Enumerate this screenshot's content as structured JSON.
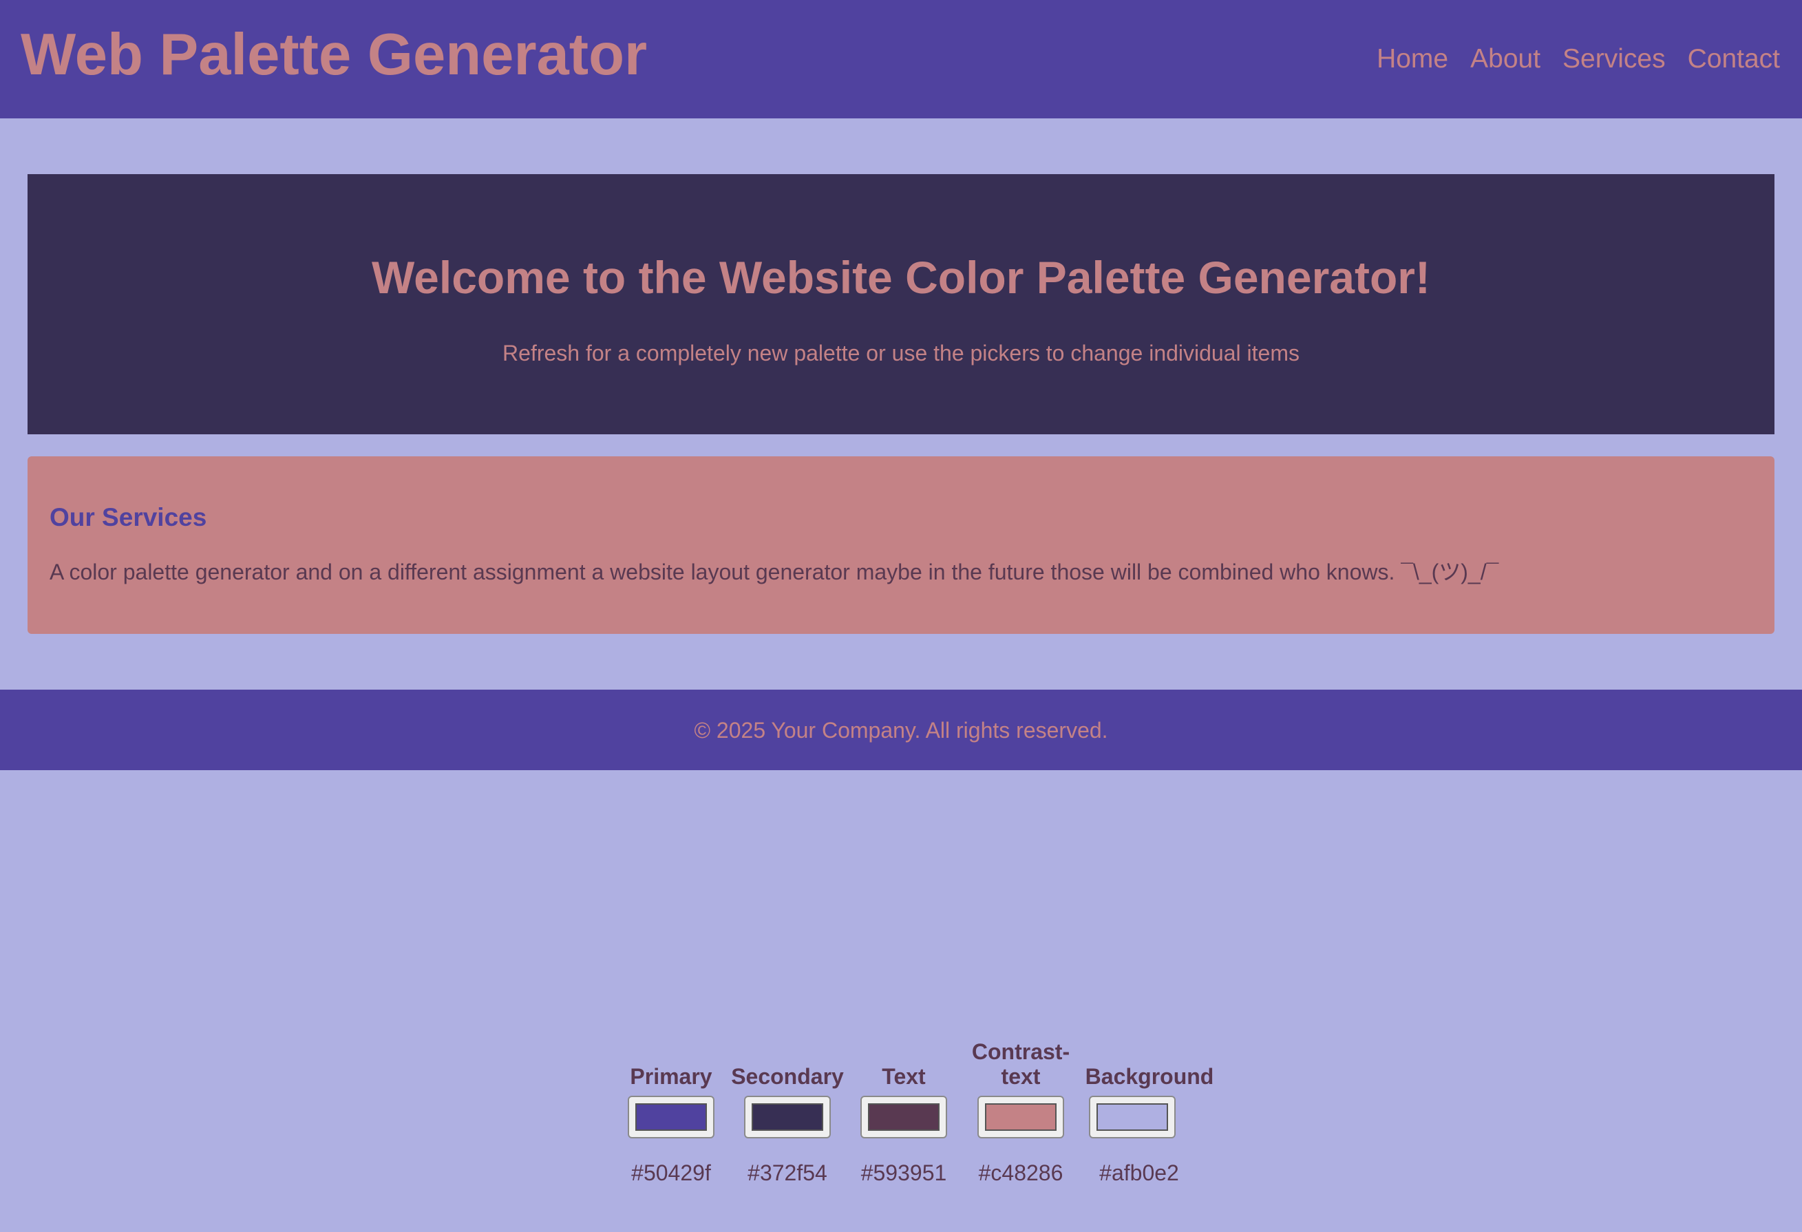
{
  "header": {
    "logo": "Web Palette Generator",
    "nav": [
      "Home",
      "About",
      "Services",
      "Contact"
    ]
  },
  "hero": {
    "title": "Welcome to the Website Color Palette Generator!",
    "subtitle": "Refresh for a completely new palette or use the pickers to change individual items"
  },
  "services": {
    "title": "Our Services",
    "text": "A color palette generator and on a different assignment a website layout generator maybe in the future those will be combined who knows. ¯\\_(ツ)_/¯"
  },
  "footer": {
    "text": "© 2025 Your Company. All rights reserved."
  },
  "pickers": [
    {
      "label": "Primary",
      "value": "#50429f",
      "color": "#50429f"
    },
    {
      "label": "Secondary",
      "value": "#372f54",
      "color": "#372f54"
    },
    {
      "label": "Text",
      "value": "#593951",
      "color": "#593951"
    },
    {
      "label": "Contrast-text",
      "value": "#c48286",
      "color": "#c48286"
    },
    {
      "label": "Background",
      "value": "#afb0e2",
      "color": "#afb0e2"
    }
  ],
  "colors": {
    "primary": "#50429f",
    "secondary": "#372f54",
    "text": "#593951",
    "contrast_text": "#c48286",
    "background": "#afb0e2"
  }
}
